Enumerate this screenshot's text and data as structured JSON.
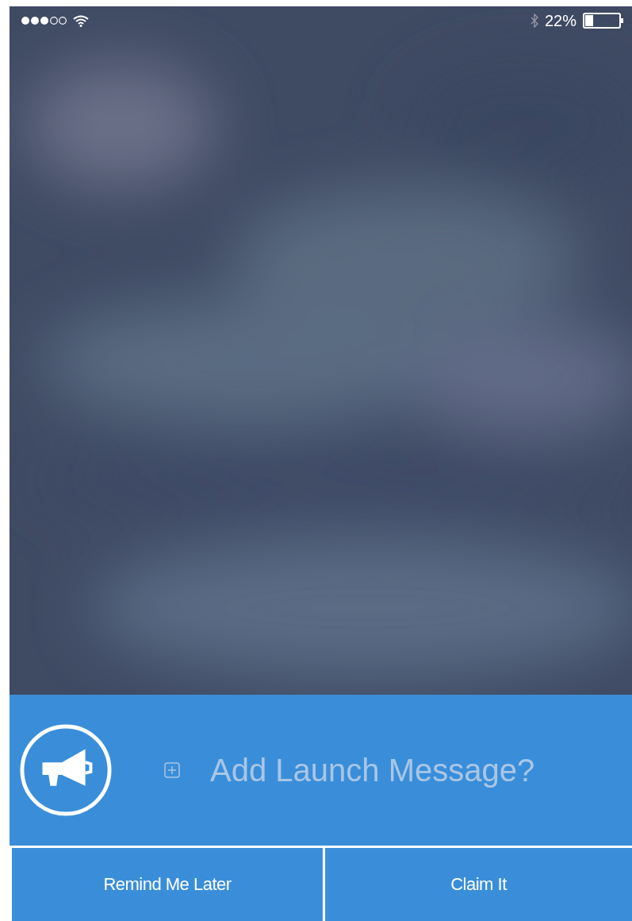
{
  "status_bar": {
    "battery": "22%"
  },
  "message": {
    "placeholder": "Add Launch Message?"
  },
  "buttons": [
    {
      "label": "Remind Me Later"
    },
    {
      "label": "Claim It"
    }
  ]
}
